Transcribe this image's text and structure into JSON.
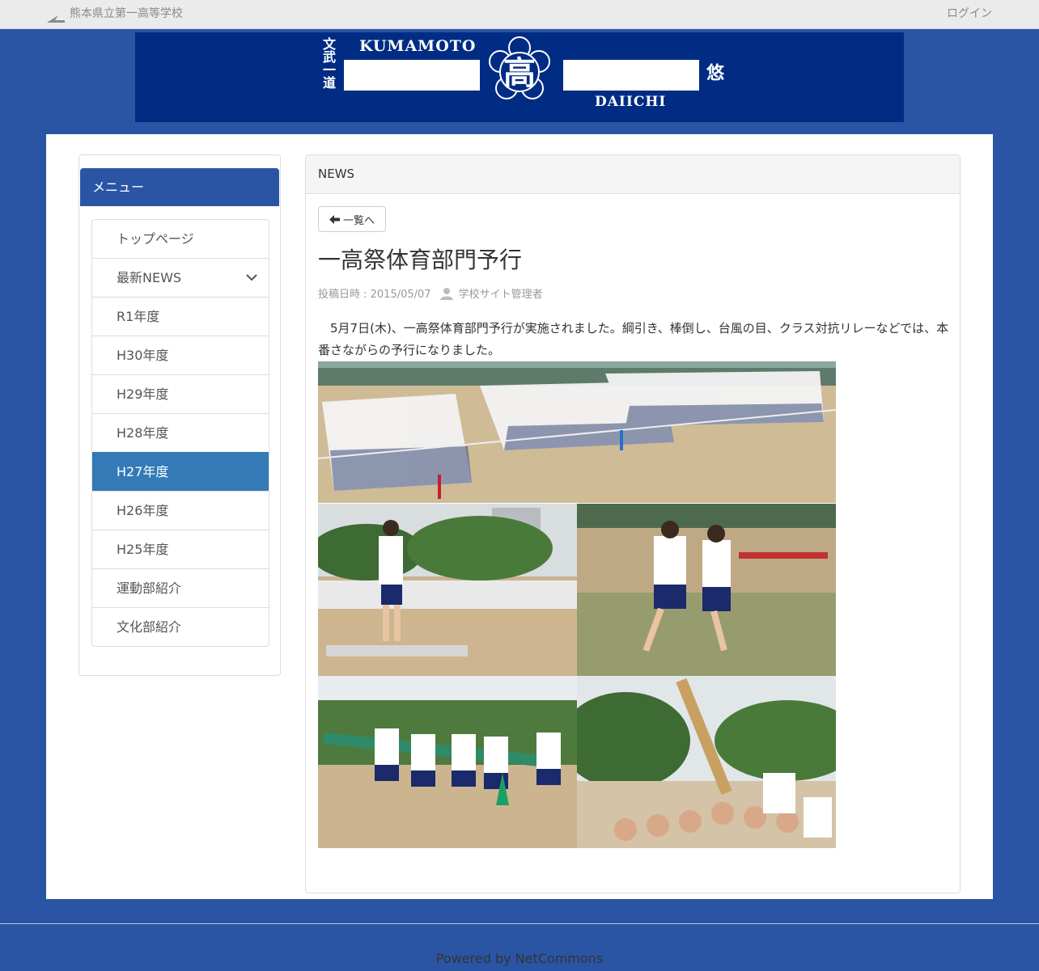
{
  "header": {
    "site_name": "熊本県立第一高等学校",
    "login_label": "ログイン"
  },
  "banner": {
    "left_text": "KUMAMOTO",
    "right_text": "DAIICHI",
    "center_char": "高",
    "left_vertical": "文武一道",
    "right_vertical": "悠"
  },
  "sidebar": {
    "heading": "メニュー",
    "items": [
      {
        "label": "トップページ",
        "active": false,
        "expandable": false
      },
      {
        "label": "最新NEWS",
        "active": false,
        "expandable": true
      },
      {
        "label": "R1年度",
        "active": false,
        "expandable": false
      },
      {
        "label": "H30年度",
        "active": false,
        "expandable": false
      },
      {
        "label": "H29年度",
        "active": false,
        "expandable": false
      },
      {
        "label": "H28年度",
        "active": false,
        "expandable": false
      },
      {
        "label": "H27年度",
        "active": true,
        "expandable": false
      },
      {
        "label": "H26年度",
        "active": false,
        "expandable": false
      },
      {
        "label": "H25年度",
        "active": false,
        "expandable": false
      },
      {
        "label": "運動部紹介",
        "active": false,
        "expandable": false
      },
      {
        "label": "文化部紹介",
        "active": false,
        "expandable": false
      }
    ]
  },
  "main": {
    "panel_title": "NEWS",
    "back_label": "一覧へ",
    "article_title": "一高祭体育部門予行",
    "posted_label": "投稿日時 : 2015/05/07",
    "author": "学校サイト管理者",
    "body": "　5月7日(木)、一高祭体育部門予行が実施されました。綱引き、棒倒し、台風の目、クラス対抗リレーなどでは、本番さながらの予行になりました。"
  },
  "footer": {
    "powered_by": "Powered by NetCommons"
  },
  "colors": {
    "page_bg": "#2a55a5",
    "banner_bg": "#002c84",
    "active_item": "#337ab7"
  }
}
